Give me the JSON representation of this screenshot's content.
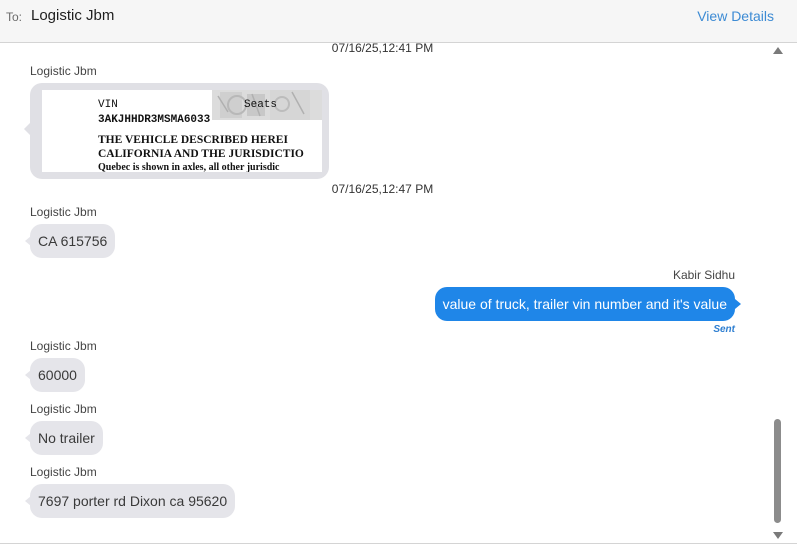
{
  "header": {
    "to_label": "To:",
    "recipient": "Logistic Jbm",
    "view_details": "View Details"
  },
  "thread": {
    "timestamps": [
      "07/16/25,12:41 PM",
      "07/16/25,12:47 PM"
    ],
    "image_message": {
      "sender": "Logistic Jbm",
      "image_text": {
        "vin_label": "VIN",
        "seats_label": "Seats",
        "vin_number": "3AKJHHDR3MSMA6033",
        "line1": "THE VEHICLE DESCRIBED HEREI",
        "line2": "CALIFORNIA AND THE JURISDICTIO",
        "line3": "Quebec is shown in axles, all other jurisdic"
      }
    },
    "messages": [
      {
        "sender": "Logistic Jbm",
        "text": "CA 615756",
        "direction": "incoming"
      },
      {
        "sender": "Kabir Sidhu",
        "text": "value of truck, trailer vin number and it's value",
        "direction": "outgoing",
        "status": "Sent"
      },
      {
        "sender": "Logistic Jbm",
        "text": "60000",
        "direction": "incoming"
      },
      {
        "sender": "Logistic Jbm",
        "text": "No trailer",
        "direction": "incoming"
      },
      {
        "sender": "Logistic Jbm",
        "text": "7697 porter rd Dixon ca 95620",
        "direction": "incoming"
      }
    ]
  },
  "colors": {
    "incoming_bubble": "#e5e5ea",
    "outgoing_bubble": "#1f86e8",
    "link": "#3d8bd4",
    "header_bg": "#f6f6f6"
  },
  "icons": {
    "scroll_up": "triangle-up-icon",
    "scroll_down": "triangle-down-icon"
  }
}
